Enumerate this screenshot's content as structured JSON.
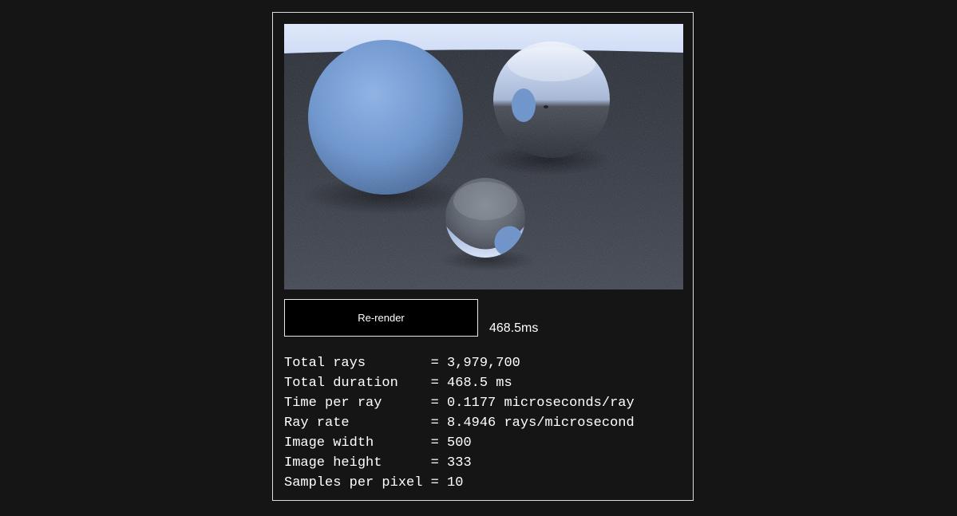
{
  "button": {
    "label": "Re-render"
  },
  "timing": "468.5ms",
  "stats": [
    {
      "label": "Total rays        ",
      "value": "3,979,700"
    },
    {
      "label": "Total duration    ",
      "value": "468.5 ms"
    },
    {
      "label": "Time per ray      ",
      "value": "0.1177 microseconds/ray"
    },
    {
      "label": "Ray rate          ",
      "value": "8.4946 rays/microsecond"
    },
    {
      "label": "Image width       ",
      "value": "500"
    },
    {
      "label": "Image height      ",
      "value": "333"
    },
    {
      "label": "Samples per pixel ",
      "value": "10"
    }
  ],
  "colors": {
    "background": "#151515",
    "sky": "#dde8fb",
    "ground": "#3c4049",
    "diffuse_sphere": "#6f98d0",
    "button_bg": "#000000",
    "text": "#ffffff"
  }
}
